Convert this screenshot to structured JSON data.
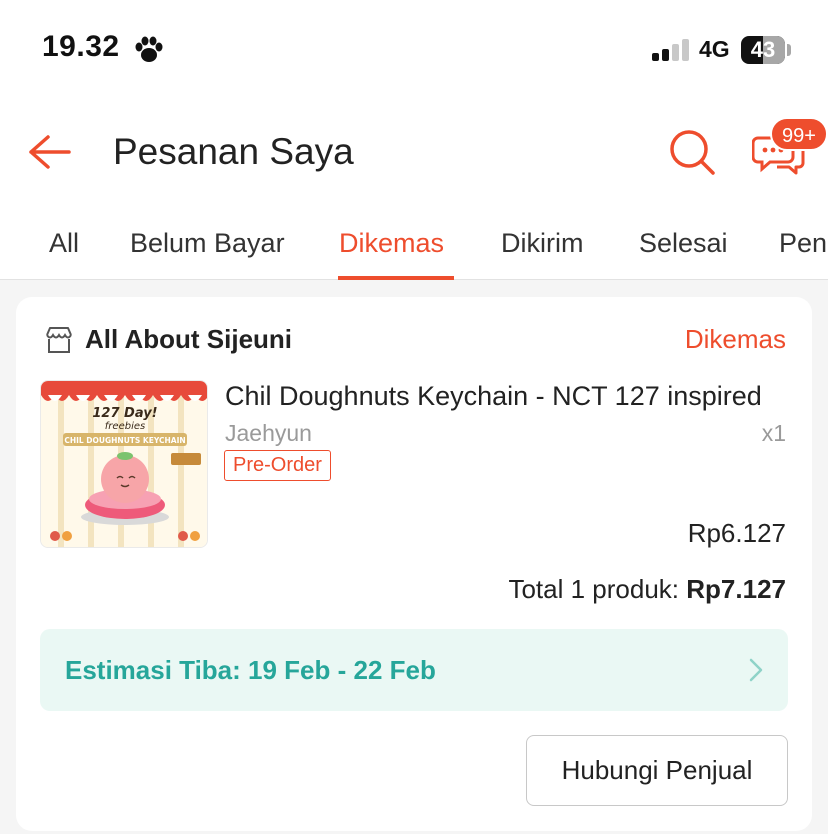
{
  "status_bar": {
    "time": "19.32",
    "network": "4G",
    "battery": "43",
    "icons": [
      "paw-icon",
      "signal-icon",
      "battery-icon"
    ]
  },
  "header": {
    "title": "Pesanan Saya",
    "chat_badge": "99+",
    "icons": [
      "back-arrow-icon",
      "search-icon",
      "chat-icon"
    ]
  },
  "tabs": [
    {
      "label": "All",
      "active": false
    },
    {
      "label": "Belum Bayar",
      "active": false
    },
    {
      "label": "Dikemas",
      "active": true
    },
    {
      "label": "Dikirim",
      "active": false
    },
    {
      "label": "Selesai",
      "active": false
    },
    {
      "label": "Pen",
      "active": false
    }
  ],
  "order": {
    "shop_name": "All About Sijeuni",
    "status": "Dikemas",
    "product": {
      "name": "Chil Doughnuts Keychain - NCT 127 inspired",
      "variant": "Jaehyun",
      "quantity": "x1",
      "tag": "Pre-Order",
      "price": "Rp6.127",
      "image_text": {
        "line1": "127 Day!",
        "line2": "freebies",
        "banner": "CHIL DOUGHNUTS KEYCHAIN"
      }
    },
    "total_label": "Total 1 produk:",
    "total_value": "Rp7.127",
    "estimate": "Estimasi Tiba: 19 Feb - 22 Feb",
    "contact_button": "Hubungi Penjual"
  },
  "colors": {
    "accent": "#ee4d2d",
    "estimate_bg": "#eaf8f4",
    "estimate_text": "#26a69a",
    "background": "#f5f5f5"
  }
}
